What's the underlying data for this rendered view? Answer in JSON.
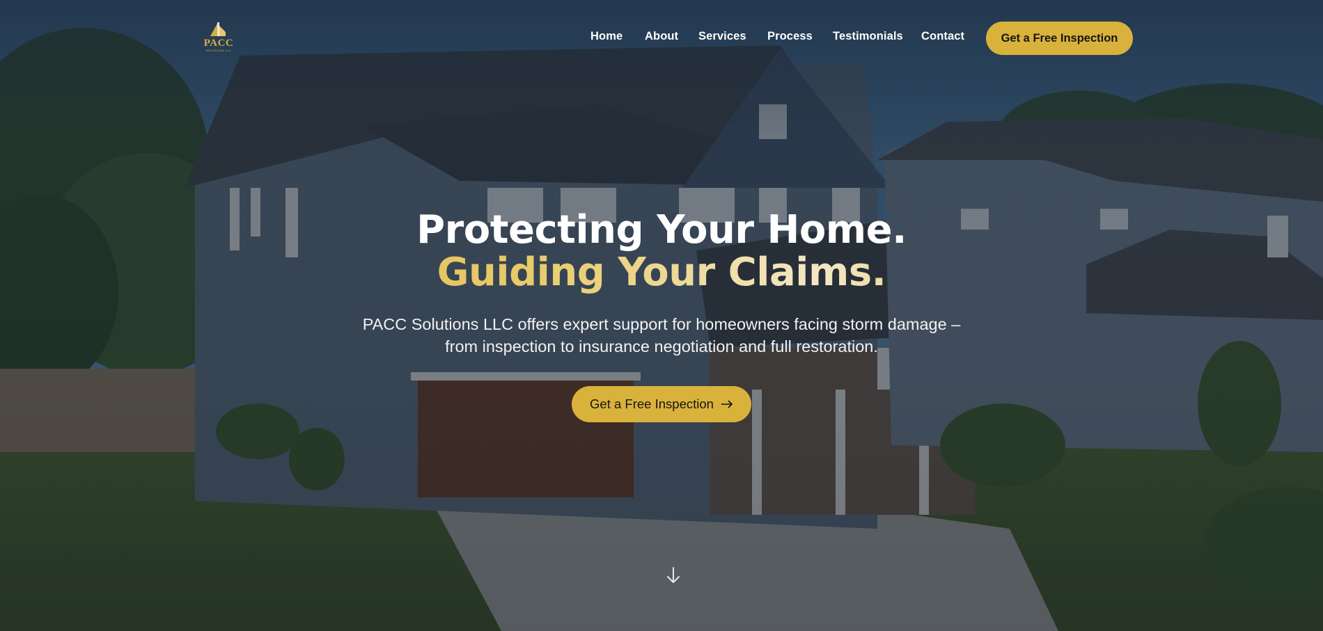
{
  "brand": {
    "logo_text": "PACC",
    "logo_subtext": "SOLUTIONS LLC",
    "accent_color": "#d9b23c"
  },
  "nav": {
    "items": [
      {
        "label": "Home"
      },
      {
        "label": "About"
      },
      {
        "label": "Services"
      },
      {
        "label": "Process"
      },
      {
        "label": "Testimonials"
      },
      {
        "label": "Contact"
      }
    ],
    "cta_label": "Get a Free Inspection"
  },
  "hero": {
    "title_line1": "Protecting Your Home.",
    "title_line2": "Guiding Your Claims.",
    "subtitle": "PACC Solutions LLC offers expert support for homeowners facing storm damage – from inspection to insurance negotiation and full restoration.",
    "cta_label": "Get a Free Inspection",
    "cta_icon": "arrow-right-icon",
    "scroll_icon": "arrow-down-icon",
    "background": "house-photo"
  }
}
